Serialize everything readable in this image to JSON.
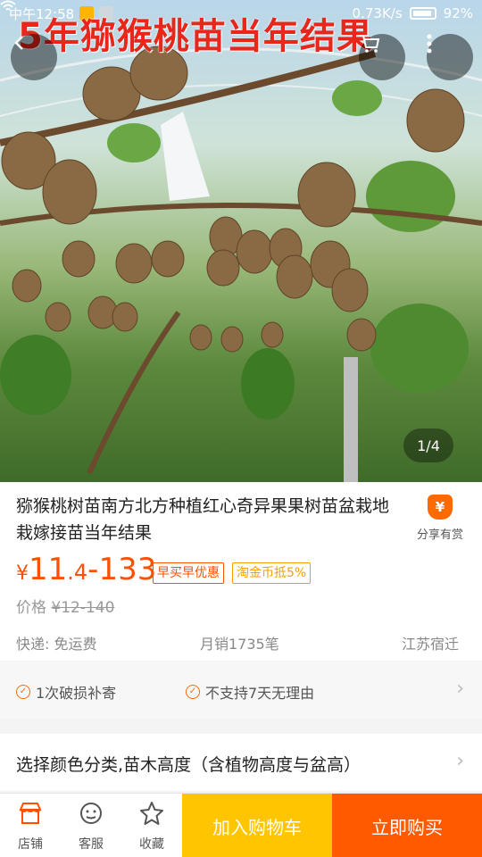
{
  "statusbar": {
    "time": "中午12:58",
    "network_speed": "0.73K/s",
    "battery": "92%"
  },
  "banner": {
    "title": "5年猕猴桃苗当年结果"
  },
  "gallery": {
    "pager": "1/4"
  },
  "product": {
    "title": "猕猴桃树苗南方北方种植红心奇异果果树苗盆栽地栽嫁接苗当年结果",
    "share_label": "分享有赏",
    "price": {
      "currency": "¥",
      "int": "11",
      "dec": ".4",
      "range_end": "-133"
    },
    "tags": [
      "早买早优惠",
      "淘金币抵5%"
    ],
    "original_price_label": "价格",
    "original_price": "¥12-140",
    "shipping": "快递: 免运费",
    "monthly_sales": "月销1735笔",
    "location": "江苏宿迁"
  },
  "guarantees": [
    "1次破损补寄",
    "不支持7天无理由"
  ],
  "sku_select": "选择颜色分类,苗木高度（含植物高度与盆高）",
  "bottom_bar": {
    "store_label": "店铺",
    "service_label": "客服",
    "favorite_label": "收藏",
    "add_to_cart_label": "加入购物车",
    "buy_now_label": "立即购买"
  },
  "colors": {
    "accent": "#ff5000",
    "cart_button": "#ffc500",
    "buy_button": "#ff5a00",
    "banner_text": "#e8261c"
  }
}
